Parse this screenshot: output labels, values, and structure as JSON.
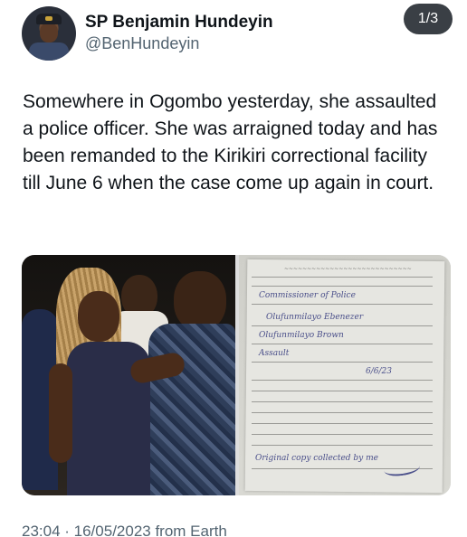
{
  "author": {
    "display_name": "SP Benjamin Hundeyin",
    "handle": "@BenHundeyin"
  },
  "media_counter": "1/3",
  "tweet": {
    "text": "Somewhere in Ogombo yesterday, she assaulted a police officer. She was arraigned today and has been remanded to the Kirikiri correctional facility till June 6 when the case come up again in court."
  },
  "media": {
    "photo_left": {
      "subject": "arrest-photo"
    },
    "photo_right": {
      "subject": "remand-warrant-document",
      "handwriting": {
        "line1": "Commissioner of Police",
        "line2": "Olufunmilayo Ebenezer",
        "line3": "Olufunmilayo Brown",
        "line4": "Assault",
        "date": "6/6/23",
        "stamp_note": "Original copy collected by me"
      }
    }
  },
  "footer": {
    "timestamp": "23:04 · 16/05/2023 from Earth"
  },
  "colors": {
    "text_primary": "#0f1419",
    "text_secondary": "#536471",
    "counter_bg": "#3a3f45"
  }
}
